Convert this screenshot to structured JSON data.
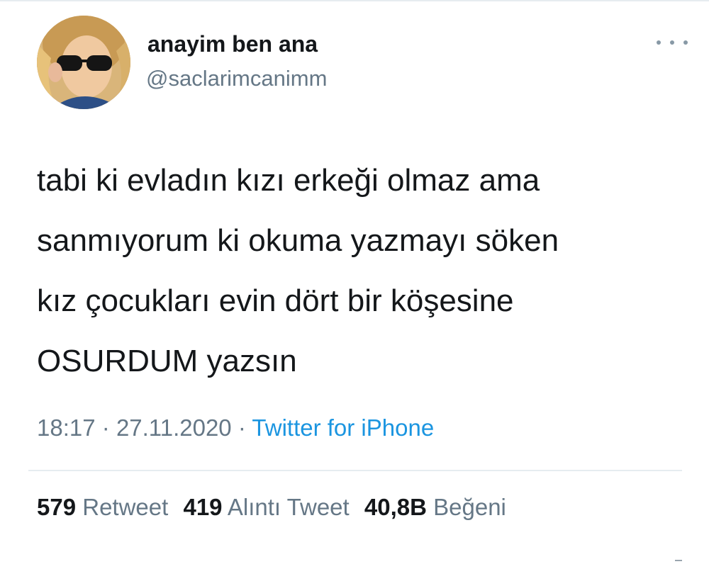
{
  "tweet": {
    "display_name": "anayim ben ana",
    "handle": "@saclarimcanimm",
    "more_icon": "more-horizontal-icon",
    "text_lines": [
      "tabi ki evladın kızı erkeği olmaz ama",
      "sanmıyorum ki okuma yazmayı söken",
      "kız çocukları evin dört bir köşesine",
      "OSURDUM yazsın"
    ],
    "time": "18:17",
    "date": "27.11.2020",
    "separator": "·",
    "source": "Twitter for iPhone"
  },
  "stats": {
    "retweets_count": "579",
    "retweets_label": "Retweet",
    "quotes_count": "419",
    "quotes_label": "Alıntı Tweet",
    "likes_count": "40,8B",
    "likes_label": "Beğeni"
  },
  "colors": {
    "text": "#14171a",
    "secondary": "#657786",
    "link": "#1b95e0",
    "divider": "#e6ecf0"
  }
}
